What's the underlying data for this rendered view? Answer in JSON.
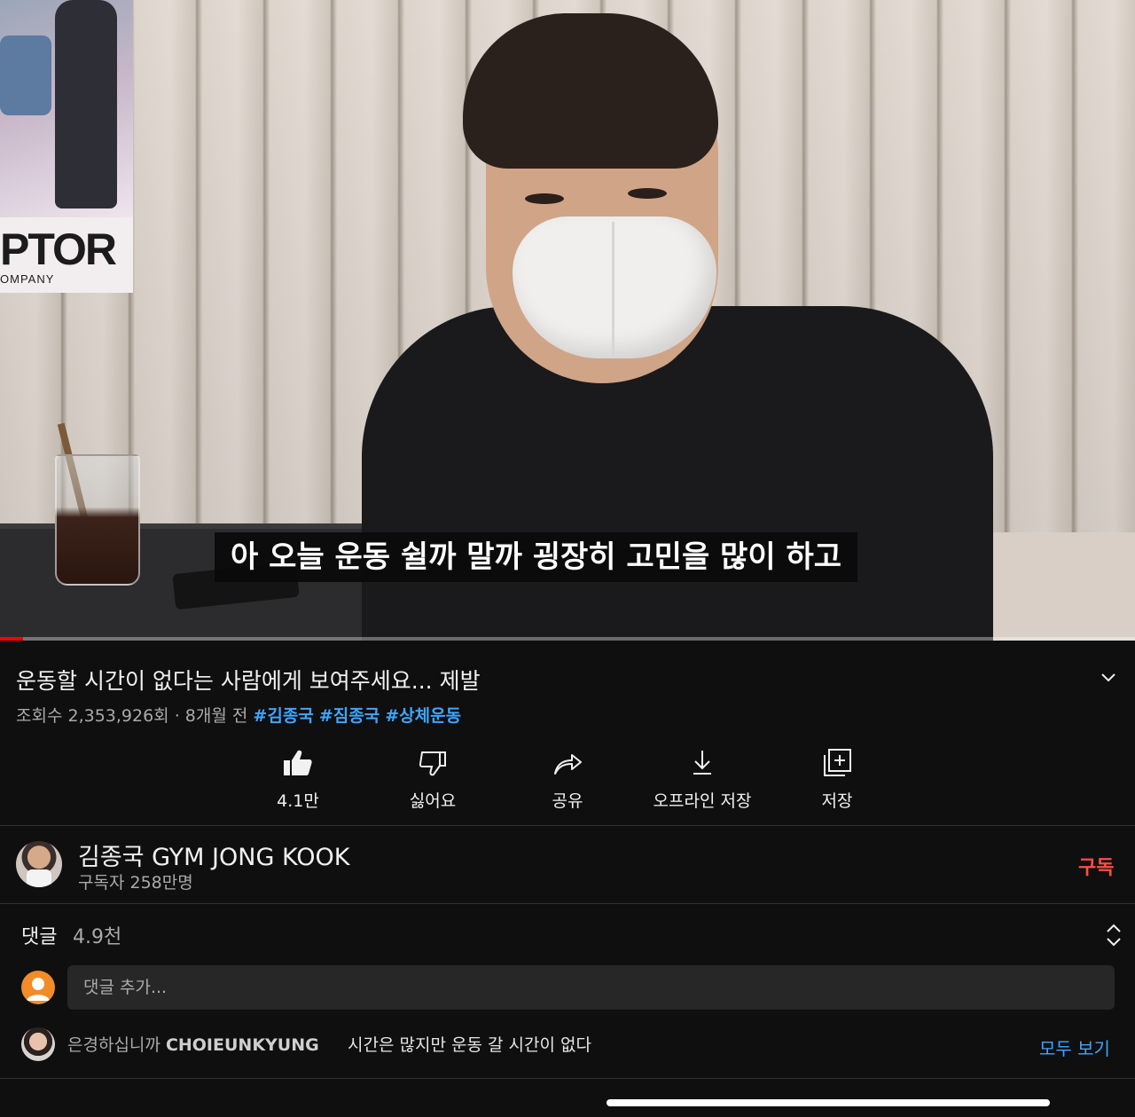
{
  "video": {
    "subtitle": "아 오늘 운동 쉴까 말까 굉장히 고민을 많이 하고",
    "poster_text": "PTOR",
    "poster_subtext": "OMPANY",
    "progress": 0.02,
    "progress_color": "#ff0000"
  },
  "details": {
    "title": "운동할 시간이 없다는 사람에게 보여주세요... 제발",
    "views": "조회수 2,353,926회",
    "separator": " · ",
    "age": "8개월 전",
    "hashtags": [
      "#김종국",
      "#짐종국",
      "#상체운동"
    ],
    "hashtag_color": "#3ea6ff"
  },
  "actions": {
    "like": {
      "label": "4.1만",
      "icon": "thumbs-up-icon"
    },
    "dislike": {
      "label": "싫어요",
      "icon": "thumbs-down-icon"
    },
    "share": {
      "label": "공유",
      "icon": "share-icon"
    },
    "download": {
      "label": "오프라인 저장",
      "icon": "download-icon"
    },
    "save": {
      "label": "저장",
      "icon": "add-to-playlist-icon"
    }
  },
  "channel": {
    "name": "김종국 GYM JONG KOOK",
    "subscribers": "구독자 258만명",
    "subscribe_label": "구독",
    "subscribe_color": "#ff4e45"
  },
  "comments": {
    "label": "댓글",
    "count": "4.9천",
    "input_placeholder": "댓글 추가...",
    "top_comment": {
      "author_prefix": "은경하십니까",
      "author_name": "CHOIEUNKYUNG",
      "text": "시간은 많지만 운동 갈 시간이 없다"
    },
    "view_all_label": "모두 보기"
  }
}
